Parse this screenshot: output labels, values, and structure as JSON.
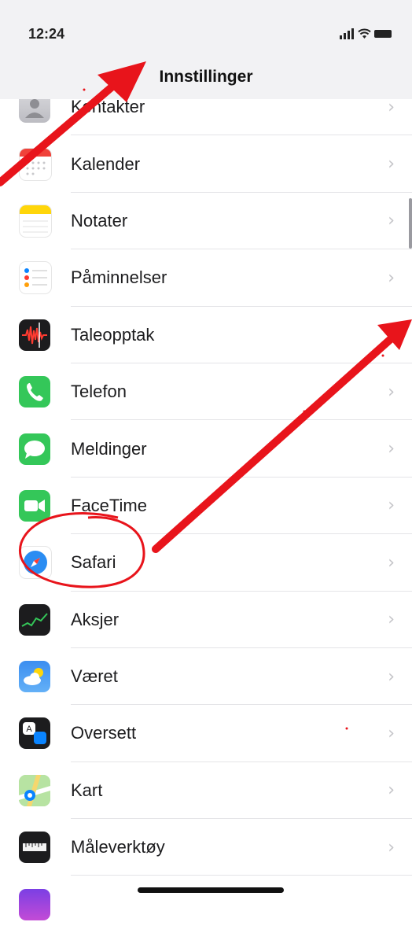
{
  "status": {
    "time": "12:24"
  },
  "header": {
    "title": "Innstillinger"
  },
  "rows": [
    {
      "label": "Kontakter",
      "icon": "contacts-icon"
    },
    {
      "label": "Kalender",
      "icon": "calendar-icon"
    },
    {
      "label": "Notater",
      "icon": "notes-icon"
    },
    {
      "label": "Påminnelser",
      "icon": "reminders-icon"
    },
    {
      "label": "Taleopptak",
      "icon": "voice-memos-icon"
    },
    {
      "label": "Telefon",
      "icon": "phone-icon"
    },
    {
      "label": "Meldinger",
      "icon": "messages-icon"
    },
    {
      "label": "FaceTime",
      "icon": "facetime-icon"
    },
    {
      "label": "Safari",
      "icon": "safari-icon"
    },
    {
      "label": "Aksjer",
      "icon": "stocks-icon"
    },
    {
      "label": "Været",
      "icon": "weather-icon"
    },
    {
      "label": "Oversett",
      "icon": "translate-icon"
    },
    {
      "label": "Kart",
      "icon": "maps-icon"
    },
    {
      "label": "Måleverktøy",
      "icon": "measure-icon"
    }
  ],
  "annotation": {
    "color": "#e8141b",
    "highlighted_item": "Safari"
  }
}
